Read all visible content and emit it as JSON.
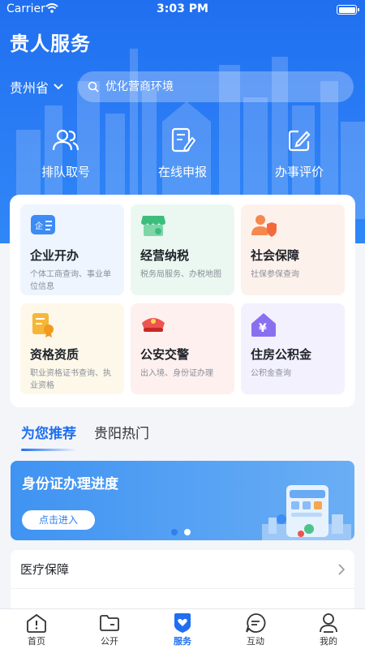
{
  "status_bar": {
    "carrier": "Carrier",
    "time": "3:03 PM"
  },
  "header": {
    "title": "贵人服务"
  },
  "region": {
    "label": "贵州省"
  },
  "search": {
    "placeholder": "优化营商环境"
  },
  "quick_actions": [
    {
      "label": "排队取号",
      "icon": "people-icon"
    },
    {
      "label": "在线申报",
      "icon": "document-edit-icon"
    },
    {
      "label": "办事评价",
      "icon": "pencil-square-icon"
    }
  ],
  "service_cards": [
    {
      "title": "企业开办",
      "desc": "个体工商查询、事业单位信息",
      "icon": "business-id-icon",
      "bg": "#eef5ff"
    },
    {
      "title": "经营纳税",
      "desc": "税务局服务、办税地图",
      "icon": "store-icon",
      "bg": "#ebf8f1"
    },
    {
      "title": "社会保障",
      "desc": "社保参保查询",
      "icon": "person-shield-icon",
      "bg": "#fdf1ec"
    },
    {
      "title": "资格资质",
      "desc": "职业资格证书查询、执业资格",
      "icon": "certificate-icon",
      "bg": "#fdf8e9"
    },
    {
      "title": "公安交警",
      "desc": "出入境、身份证办理",
      "icon": "police-cap-icon",
      "bg": "#fdf0ef"
    },
    {
      "title": "住房公积金",
      "desc": "公积金查询",
      "icon": "house-yuan-icon",
      "bg": "#f3f1fd"
    }
  ],
  "recommend_tabs": [
    {
      "label": "为您推荐",
      "active": true
    },
    {
      "label": "贵阳热门",
      "active": false
    }
  ],
  "banner": {
    "title": "身份证办理进度",
    "button": "点击进入",
    "slide_count": 2,
    "active_slide": 1
  },
  "list_items": [
    {
      "label": "医疗保障"
    }
  ],
  "tab_bar": [
    {
      "label": "首页",
      "icon": "home-info-icon",
      "active": false
    },
    {
      "label": "公开",
      "icon": "folder-icon",
      "active": false
    },
    {
      "label": "服务",
      "icon": "shield-heart-icon",
      "active": true
    },
    {
      "label": "互动",
      "icon": "chat-icon",
      "active": false
    },
    {
      "label": "我的",
      "icon": "user-icon",
      "active": false
    }
  ],
  "colors": {
    "primary": "#1f6ff0",
    "hero_bg": "#2c7ef5",
    "banner_bg": "#4a9af3"
  }
}
